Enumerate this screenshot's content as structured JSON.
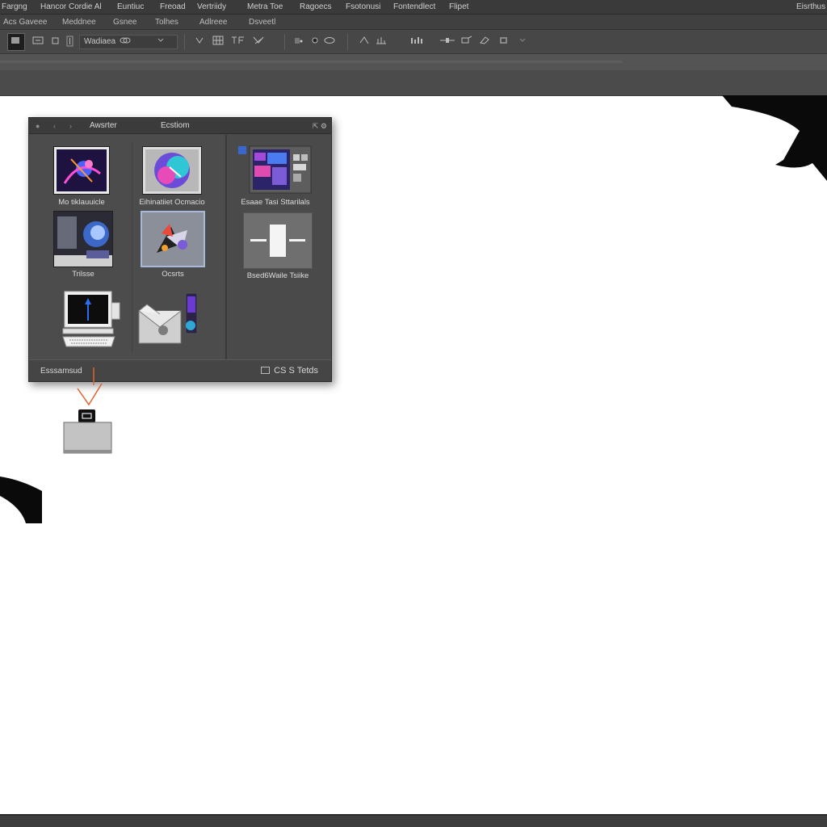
{
  "menubar": {
    "items": [
      "Fargng",
      "Hancor Cordie Al",
      "Euntiuc",
      "Freoad",
      "Vertriidy",
      "Metra Toe",
      "Ragoecs",
      "Fsotonusi",
      "Fontendlect",
      "Flipet"
    ],
    "right_label": "Eisrthus"
  },
  "tabbar": {
    "items": [
      "Acs Gaveee",
      "Meddnee",
      "Gsnee",
      "Tolhes",
      "Adlreee",
      "Dsveetl"
    ]
  },
  "optionsbar": {
    "field_label": "Wadiaea",
    "icons": [
      "tool-preset-icon",
      "new-icon",
      "square-icon",
      "align-icon",
      "link-icon",
      "dropdown-chevron-icon",
      "grid-icon",
      "transform-icon",
      "warp-icon",
      "shape-icon",
      "layer-icon",
      "path-icon",
      "chart-icon",
      "arrange-icon",
      "pen-icon",
      "cloud-icon",
      "chevron-icon"
    ]
  },
  "dialog": {
    "title_left": "Awsrter",
    "title_center": "Ecstiom",
    "left_pane": {
      "items": [
        {
          "label": "Mo tiklauuicle"
        },
        {
          "label": "Eihinatiiet Ocmacio"
        },
        {
          "label": "Trilsse"
        },
        {
          "label": "Ocsrts"
        },
        {
          "label": ""
        },
        {
          "label": ""
        }
      ]
    },
    "right_pane": {
      "items": [
        {
          "label": "Esaae Tasi Sttarilals"
        },
        {
          "label": "Bsed6Waile Tsiike"
        }
      ]
    },
    "footer_left": "Esssamsud",
    "footer_right": "CS S Tetds"
  },
  "connector": {
    "color": "#e0622a"
  },
  "colors": {
    "accent": "#e0622a",
    "chrome": "#3a3a3a",
    "canvas": "#ffffff"
  }
}
